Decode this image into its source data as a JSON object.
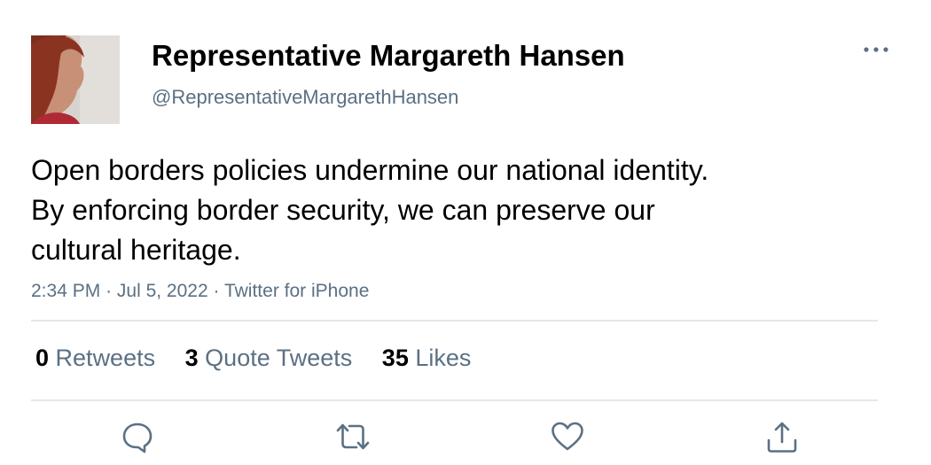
{
  "author": {
    "display_name": "Representative Margareth Hansen",
    "handle": "@RepresentativeMargarethHansen",
    "avatar_icon": "profile-photo"
  },
  "tweet": {
    "lines": [
      "Open borders policies undermine our national identity.",
      "By enforcing border security, we can preserve our",
      "cultural heritage."
    ],
    "time": "2:34 PM",
    "date": "Jul 5, 2022",
    "source": "Twitter for iPhone",
    "separator": "·"
  },
  "stats": {
    "retweets": {
      "count": "0",
      "label": "Retweets"
    },
    "quotes": {
      "count": "3",
      "label": "Quote Tweets"
    },
    "likes": {
      "count": "35",
      "label": "Likes"
    }
  },
  "actions": [
    {
      "name": "reply",
      "icon": "speech-bubble-icon"
    },
    {
      "name": "retweet",
      "icon": "retweet-arrows-icon"
    },
    {
      "name": "like",
      "icon": "heart-icon"
    },
    {
      "name": "share",
      "icon": "share-upload-icon"
    }
  ],
  "colors": {
    "text_primary": "#000000",
    "text_secondary": "#5b7083",
    "divider": "#e1e8ed"
  }
}
